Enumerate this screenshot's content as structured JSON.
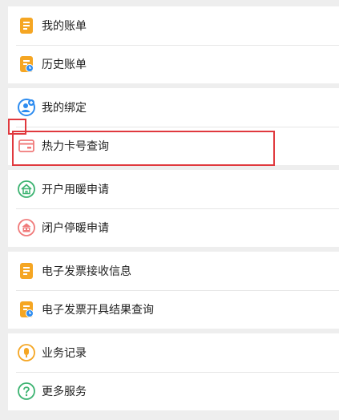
{
  "menu": {
    "group1": [
      {
        "label": "我的账单",
        "icon": "bill-icon"
      },
      {
        "label": "历史账单",
        "icon": "history-bill-icon"
      }
    ],
    "group2": [
      {
        "label": "我的绑定",
        "icon": "add-user-icon"
      },
      {
        "label": "热力卡号查询",
        "icon": "card-icon"
      }
    ],
    "group3": [
      {
        "label": "开户用暖申请",
        "icon": "home-heating-icon"
      },
      {
        "label": "闭户停暖申请",
        "icon": "building-close-icon"
      }
    ],
    "group4": [
      {
        "label": "电子发票接收信息",
        "icon": "invoice-icon"
      },
      {
        "label": "电子发票开具结果查询",
        "icon": "invoice-query-icon"
      }
    ],
    "group5": [
      {
        "label": "业务记录",
        "icon": "record-icon"
      },
      {
        "label": "更多服务",
        "icon": "help-icon"
      }
    ]
  },
  "colors": {
    "background": "#eeeeee",
    "orange": "#f5a623",
    "blue": "#2d8cf0",
    "pink": "#f07a7a",
    "green": "#3cb371",
    "highlight": "#e0393e"
  }
}
